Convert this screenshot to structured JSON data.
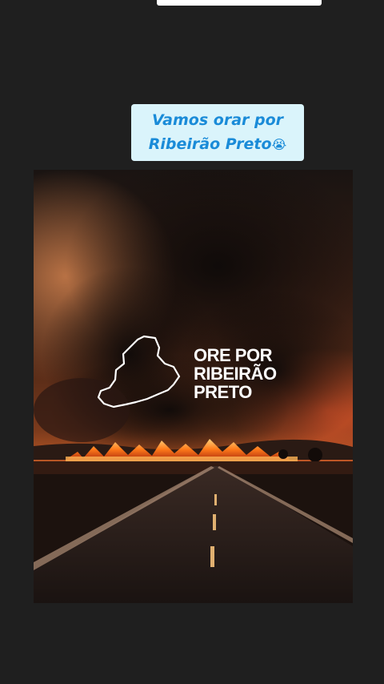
{
  "story": {
    "caption": {
      "line1": "Vamos orar por",
      "line2": "Ribeirão Preto",
      "emoji": "😭"
    },
    "post": {
      "headline_line1": "ORE POR",
      "headline_line2": "RIBEIRÃO",
      "headline_line3": "PRETO",
      "map_icon": "region-outline-icon"
    }
  },
  "colors": {
    "background": "#1f1f1f",
    "caption_bg": "#daf4fb",
    "caption_text": "#1a8bd8",
    "fire": "#ff7a1a"
  }
}
